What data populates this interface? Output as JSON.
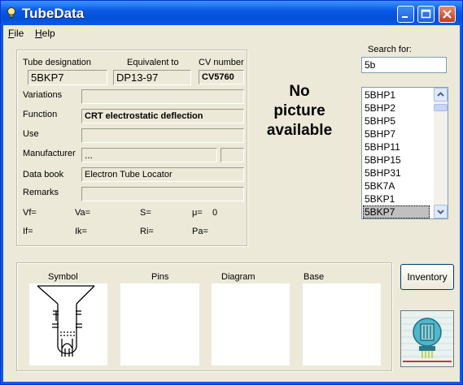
{
  "window": {
    "title": "TubeData"
  },
  "menu": [
    {
      "accel": "F",
      "rest": "ile"
    },
    {
      "accel": "H",
      "rest": "elp"
    }
  ],
  "record": {
    "designation_label": "Tube designation",
    "designation": "5BKP7",
    "equivalent_label": "Equivalent to",
    "equivalent": "DP13-97",
    "cv_label": "CV number",
    "cv": "CV5760",
    "variations_label": "Variations",
    "variations": "",
    "function_label": "Function",
    "function": "CRT electrostatic deflection",
    "use_label": "Use",
    "use": "",
    "manufacturer_label": "Manufacturer",
    "manufacturer": "...",
    "manufacturer_code": "",
    "databook_label": "Data book",
    "databook": "Electron Tube Locator",
    "remarks_label": "Remarks",
    "remarks": "",
    "params": {
      "vf": "Vf=",
      "va": "Va=",
      "s": "S=",
      "mu": "μ=",
      "mu_value": "0",
      "if": "If=",
      "ik": "Ik=",
      "ri": "Ri=",
      "pa": "Pa="
    }
  },
  "picture": {
    "no_picture": [
      "No",
      "picture",
      "available"
    ]
  },
  "search": {
    "label": "Search for:",
    "value": "5b"
  },
  "results": {
    "items": [
      "5BHP1",
      "5BHP2",
      "5BHP5",
      "5BHP7",
      "5BHP11",
      "5BHP15",
      "5BHP31",
      "5BK7A",
      "5BKP1",
      "5BKP7"
    ],
    "selected": "5BKP7"
  },
  "panels": {
    "symbol": "Symbol",
    "pins": "Pins",
    "diagram": "Diagram",
    "base": "Base"
  },
  "buttons": {
    "inventory": "Inventory"
  },
  "colors": {
    "titlebar": "#0a5ae6",
    "face": "#ece9d8",
    "close": "#c63c17"
  }
}
